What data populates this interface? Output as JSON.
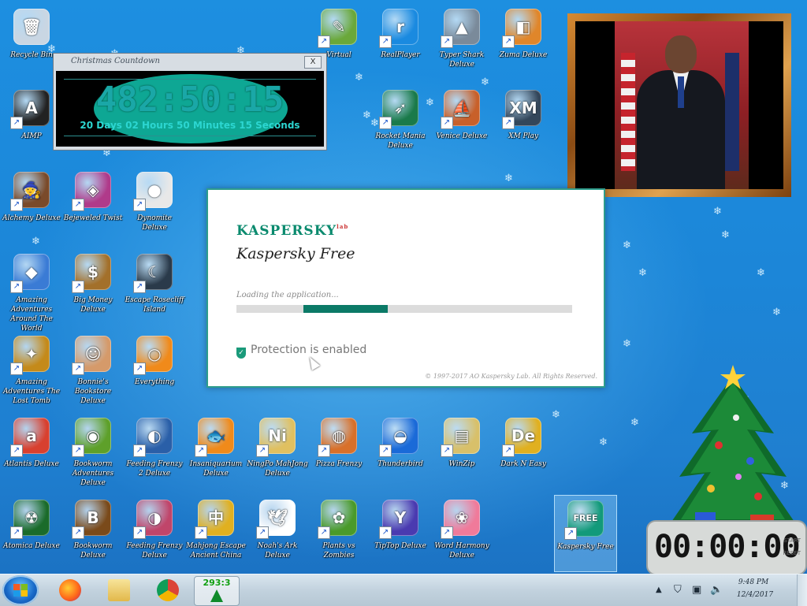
{
  "desktop": {
    "icons": [
      {
        "label": "Recycle Bin",
        "glyph": "🗑",
        "color": "#c9d6e3",
        "shortcut": false
      },
      {
        "label": "AIMP",
        "glyph": "A",
        "color": "#222222",
        "shortcut": true
      },
      {
        "label": "Alchemy Deluxe",
        "glyph": "🧙",
        "color": "#7a4a2a",
        "shortcut": true
      },
      {
        "label": "Amazing Adventures Around The World",
        "glyph": "◆",
        "color": "#3a7bd5",
        "shortcut": true
      },
      {
        "label": "Amazing Adventures The Lost Tomb",
        "glyph": "✦",
        "color": "#c48a1a",
        "shortcut": true
      },
      {
        "label": "Atlantis Deluxe",
        "glyph": "a",
        "color": "#d8402f",
        "shortcut": true
      },
      {
        "label": "Atomica Deluxe",
        "glyph": "☢",
        "color": "#1a6b2a",
        "shortcut": true
      },
      {
        "label": "Bejeweled Twist",
        "glyph": "◈",
        "color": "#b03a8a",
        "shortcut": true
      },
      {
        "label": "Big Money Deluxe",
        "glyph": "$",
        "color": "#a3702a",
        "shortcut": true
      },
      {
        "label": "Bonnie's Bookstore Deluxe",
        "glyph": "☺",
        "color": "#d59a6a",
        "shortcut": true
      },
      {
        "label": "Bookworm Adventures Deluxe",
        "glyph": "◉",
        "color": "#5ea02a",
        "shortcut": true
      },
      {
        "label": "Bookworm Deluxe",
        "glyph": "B",
        "color": "#7a4a1a",
        "shortcut": true
      },
      {
        "label": "Feeding Frenzy 2 Deluxe",
        "glyph": "◐",
        "color": "#2a5fa8",
        "shortcut": true
      },
      {
        "label": "Feeding Frenzy Deluxe",
        "glyph": "◑",
        "color": "#c0456a",
        "shortcut": true
      },
      {
        "label": "Dynomite Deluxe",
        "glyph": "●",
        "color": "#e8e8e8",
        "shortcut": true
      },
      {
        "label": "Escape Rosecliff Island",
        "glyph": "☾",
        "color": "#2a3a4a",
        "shortcut": true
      },
      {
        "label": "Everything",
        "glyph": "○",
        "color": "#f08a1a",
        "shortcut": true
      },
      {
        "label": "Insaniquarium Deluxe",
        "glyph": "🐟",
        "color": "#f08a1a",
        "shortcut": true
      },
      {
        "label": "Mahjong Escape Ancient China",
        "glyph": "中",
        "color": "#e0b020",
        "shortcut": true
      },
      {
        "label": "NingPo MahJong Deluxe",
        "glyph": "Ni",
        "color": "#e0c060",
        "shortcut": true
      },
      {
        "label": "Noah's Ark Deluxe",
        "glyph": "🕊",
        "color": "#ffffff",
        "shortcut": true
      },
      {
        "label": "Pizza Frenzy",
        "glyph": "◍",
        "color": "#d8702a",
        "shortcut": true
      },
      {
        "label": "Plants vs Zombies",
        "glyph": "✿",
        "color": "#4a9a2a",
        "shortcut": true
      },
      {
        "label": "Thunderbird",
        "glyph": "◒",
        "color": "#1a6ad8",
        "shortcut": true
      },
      {
        "label": "TipTop Deluxe",
        "glyph": "Y",
        "color": "#4a3ab0",
        "shortcut": true
      },
      {
        "label": "WinZip",
        "glyph": "▤",
        "color": "#d8c06a",
        "shortcut": true
      },
      {
        "label": "Word Harmony Deluxe",
        "glyph": "❀",
        "color": "#f07a9a",
        "shortcut": true
      },
      {
        "label": "Dark N Easy",
        "glyph": "De",
        "color": "#e0b020",
        "shortcut": true
      },
      {
        "label": "Kaspersky Free",
        "glyph": "FREE",
        "color": "#129a7a",
        "shortcut": true,
        "selected": true
      },
      {
        "label": "Virtual",
        "glyph": "✎",
        "color": "#6aa83a",
        "shortcut": true
      },
      {
        "label": "RealPlayer",
        "glyph": "r",
        "color": "#1a8ae0",
        "shortcut": true
      },
      {
        "label": "Typer Shark Deluxe",
        "glyph": "▲",
        "color": "#7a8a9a",
        "shortcut": true
      },
      {
        "label": "Zuma Deluxe",
        "glyph": "◧",
        "color": "#e0862a",
        "shortcut": true
      },
      {
        "label": "Rocket Mania Deluxe",
        "glyph": "➶",
        "color": "#1a7a4a",
        "shortcut": true
      },
      {
        "label": "Venice Deluxe",
        "glyph": "⛵",
        "color": "#c8602a",
        "shortcut": true
      },
      {
        "label": "XM Play",
        "glyph": "XM",
        "color": "#33465a",
        "shortcut": true
      }
    ]
  },
  "countdown": {
    "title": "Christmas Countdown",
    "time": "482:50:15",
    "detail": "20 Days 02 Hours 50 Minutes 15 Seconds",
    "close_label": "X"
  },
  "kaspersky": {
    "brand": "KASPERSKY",
    "brand_sup": "lab",
    "product": "Kaspersky Free",
    "loading_text": "Loading the application...",
    "progress": 0.45,
    "progress_start": 0.2,
    "protection_status": "Protection is enabled",
    "copyright": "© 1997-2017 AO Kaspersky Lab. All Rights Reserved."
  },
  "clock_widget": {
    "time": "00:00:00",
    "start_label": "START",
    "reset_label": "RESET"
  },
  "taskbar": {
    "active_label": "293:3",
    "tray": {
      "time": "9:48 PM",
      "date": "12/4/2017"
    }
  }
}
